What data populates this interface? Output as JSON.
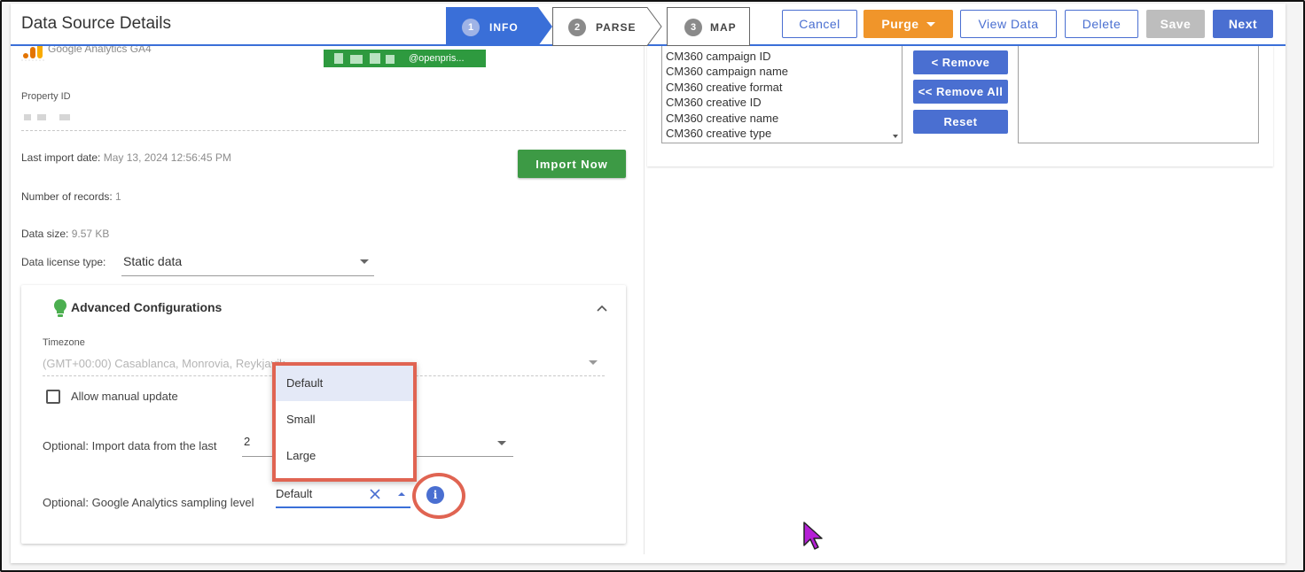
{
  "header": {
    "title": "Data Source Details",
    "steps": [
      {
        "num": "1",
        "label": "INFO",
        "active": true
      },
      {
        "num": "2",
        "label": "PARSE",
        "active": false
      },
      {
        "num": "3",
        "label": "MAP",
        "active": false
      }
    ],
    "buttons": {
      "cancel": "Cancel",
      "purge": "Purge",
      "view_data": "View Data",
      "delete": "Delete",
      "save": "Save",
      "next": "Next"
    }
  },
  "source": {
    "connector_name": "Google Analytics GA4",
    "account_email": "@openpris..."
  },
  "property": {
    "label": "Property ID"
  },
  "import_info": {
    "last_import_label": "Last import date:",
    "last_import_value": "May 13, 2024 12:56:45 PM",
    "records_label": "Number of records:",
    "records_value": "1",
    "size_label": "Data size:",
    "size_value": "9.57 KB",
    "import_now": "Import Now"
  },
  "license": {
    "label": "Data license type:",
    "value": "Static data"
  },
  "advanced": {
    "title": "Advanced Configurations",
    "timezone_label": "Timezone",
    "timezone_value": "(GMT+00:00) Casablanca, Monrovia, Reykjavik",
    "manual_update_label": "Allow manual update",
    "import_last_label": "Optional: Import data from the last",
    "import_last_value": "2",
    "sampling_label": "Optional: Google Analytics sampling level",
    "sampling_value": "Default",
    "sampling_options": [
      "Default",
      "Small",
      "Large"
    ],
    "info_glyph": "i"
  },
  "fields": {
    "available": [
      "CM360 campaign ID",
      "CM360 campaign name",
      "CM360 creative format",
      "CM360 creative ID",
      "CM360 creative name",
      "CM360 creative type"
    ],
    "remove": "< Remove",
    "remove_all": "<< Remove All",
    "reset": "Reset"
  },
  "colors": {
    "primary": "#4a6fd1",
    "purge": "#f0952a",
    "import": "#3d9a45",
    "highlight": "#e06452",
    "active_step": "#3a6fd8"
  }
}
